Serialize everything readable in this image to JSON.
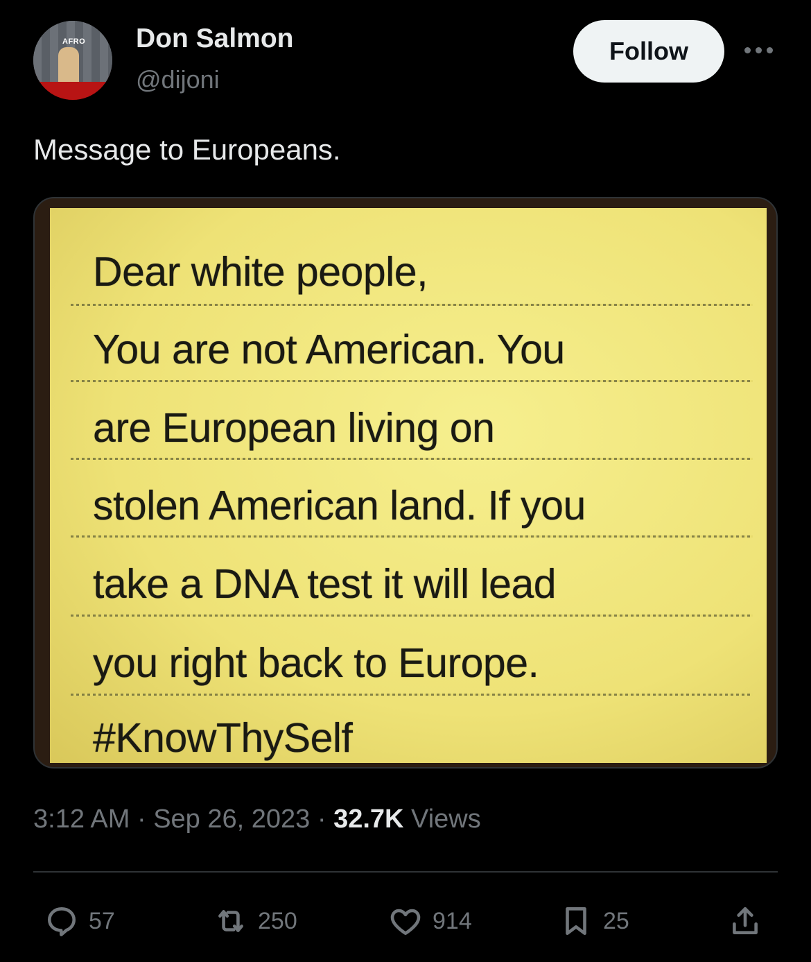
{
  "author": {
    "name": "Don Salmon",
    "handle": "@dijoni",
    "avatar_sign": "AFRO"
  },
  "follow_label": "Follow",
  "tweet": {
    "text": "Message to Europeans."
  },
  "image_note": {
    "lines": [
      "Dear white people,",
      "You are not American. You",
      "are European living on",
      "stolen American land. If you",
      "take a DNA test it will lead",
      "you right back to Europe.",
      "#KnowThySelf"
    ]
  },
  "meta": {
    "time": "3:12 AM",
    "date": "Sep 26, 2023",
    "views_count": "32.7K",
    "views_label": "Views"
  },
  "actions": {
    "replies": "57",
    "reposts": "250",
    "likes": "914",
    "bookmarks": "25"
  },
  "icons": [
    "more-icon",
    "reply-icon",
    "repost-icon",
    "like-icon",
    "bookmark-icon",
    "share-icon"
  ]
}
